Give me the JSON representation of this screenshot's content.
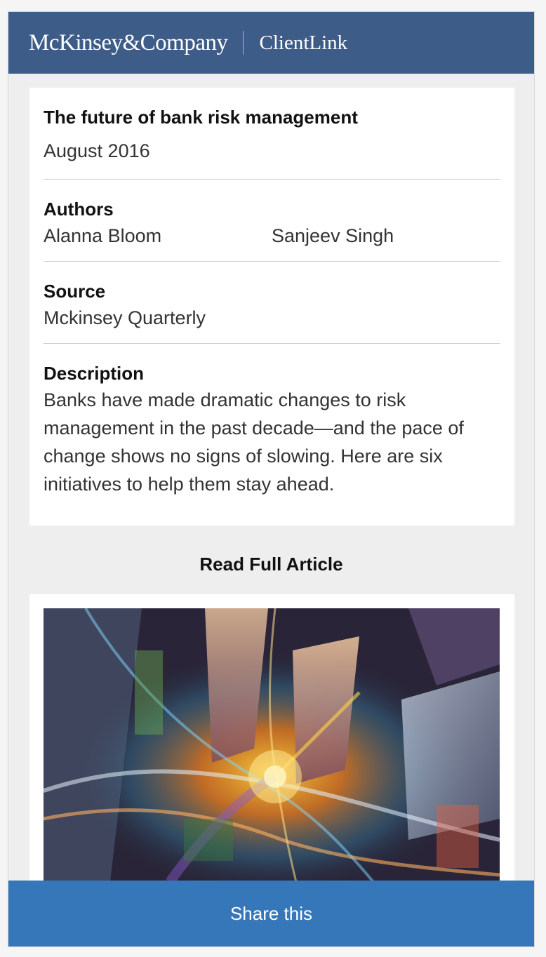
{
  "header": {
    "brand": "McKinsey&Company",
    "product": "ClientLink",
    "background_color": "#3e5c88"
  },
  "article": {
    "title": "The future of bank risk management",
    "date": "August 2016",
    "authors_label": "Authors",
    "authors": [
      "Alanna Bloom",
      "Sanjeev Singh"
    ],
    "source_label": "Source",
    "source": "Mckinsey Quarterly",
    "description_label": "Description",
    "description": "Banks have made dramatic changes to risk management in the past decade—and the pace of change shows no signs of slowing. Here are six initiatives to help them stay ahead."
  },
  "read_full_label": "Read Full Article",
  "hero_image": {
    "icon": "city-aerial-night-image"
  },
  "share": {
    "label": "Share this",
    "color": "#3577b8"
  }
}
